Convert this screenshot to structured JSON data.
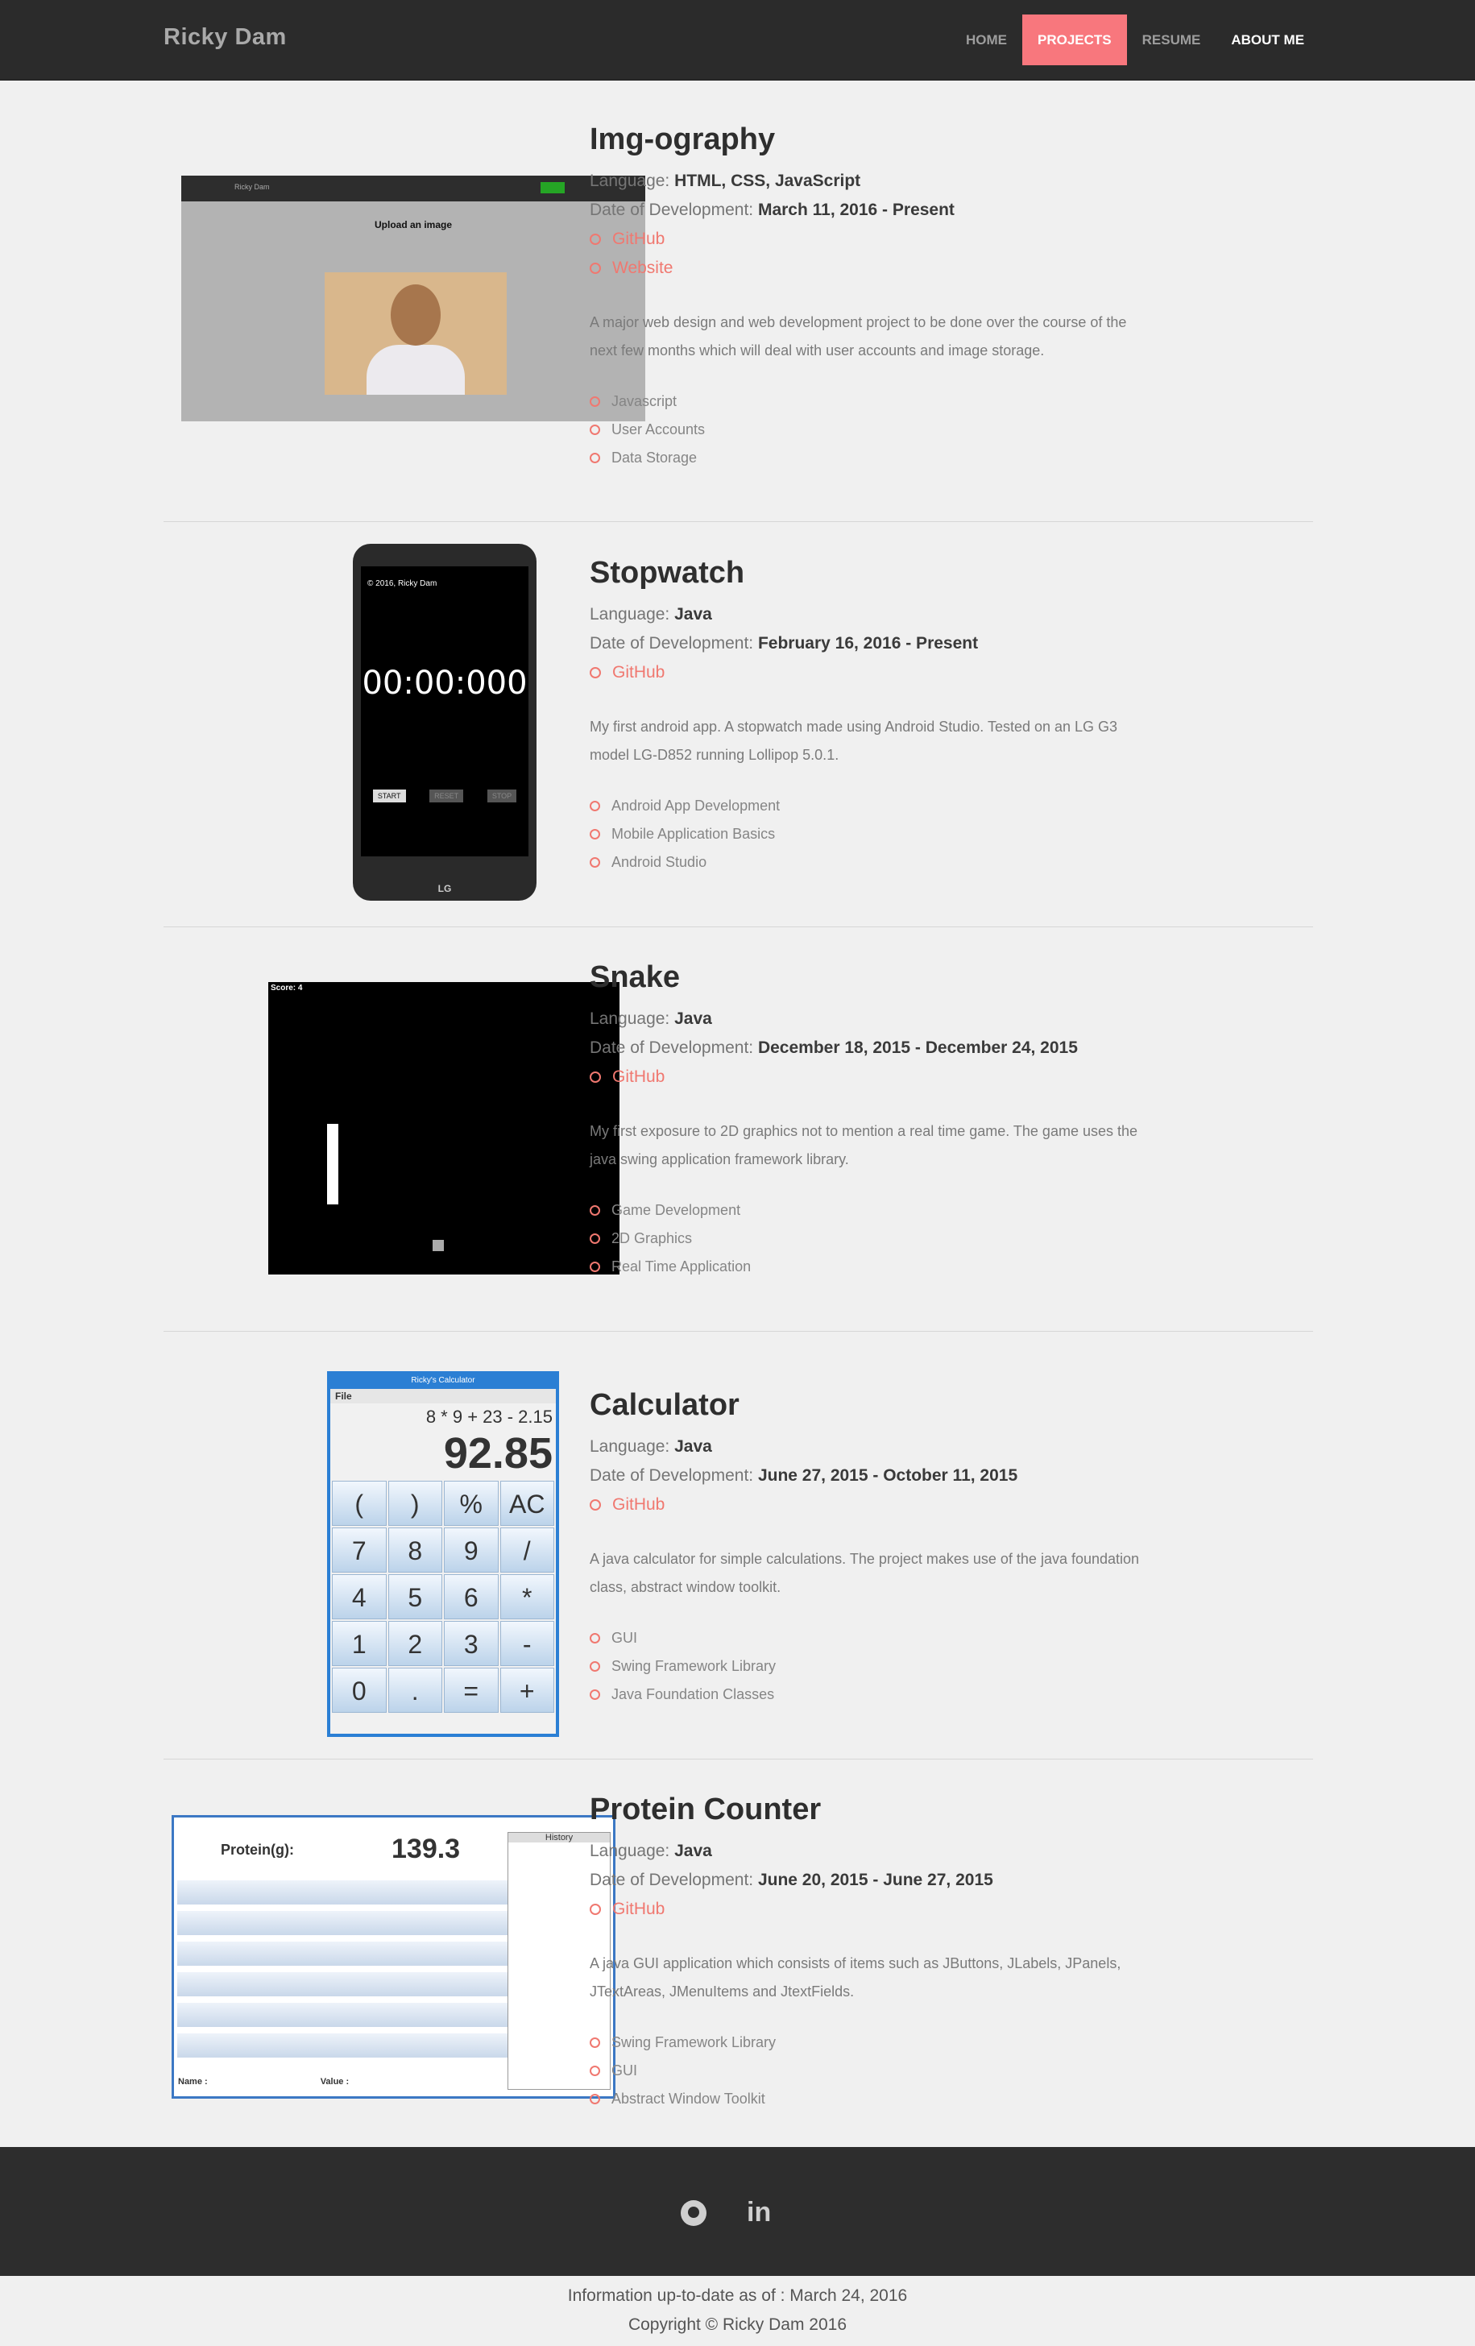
{
  "header": {
    "brand": "Ricky Dam",
    "nav": [
      "HOME",
      "PROJECTS",
      "RESUME",
      "ABOUT ME"
    ]
  },
  "projects": [
    {
      "title": "Img-ography",
      "language_label": "Language: ",
      "language": "HTML, CSS, JavaScript",
      "date_label": "Date of Development: ",
      "date": "March 11, 2016 - Present",
      "links": [
        "GitHub",
        "Website"
      ],
      "description": "A major web design and web development project to be done over the course of the next few months which will deal with user accounts and image storage.",
      "tags": [
        "Javascript",
        "User Accounts",
        "Data Storage"
      ],
      "screenshot": {
        "brand": "Ricky Dam",
        "heading": "Upload an image"
      }
    },
    {
      "title": "Stopwatch",
      "language_label": "Language: ",
      "language": "Java",
      "date_label": "Date of Development: ",
      "date": "February 16, 2016 - Present",
      "links": [
        "GitHub"
      ],
      "description": "My first android app. A stopwatch made using Android Studio. Tested on an LG G3 model LG-D852 running Lollipop 5.0.1.",
      "tags": [
        "Android App Development",
        "Mobile Application Basics",
        "Android Studio"
      ],
      "screenshot": {
        "copyright": "© 2016, Ricky Dam",
        "time": "00:00:000",
        "buttons": [
          "START",
          "RESET",
          "STOP"
        ],
        "brand": "LG"
      }
    },
    {
      "title": "Snake",
      "language_label": "Language: ",
      "language": "Java",
      "date_label": "Date of Development: ",
      "date": "December 18, 2015 - December 24, 2015",
      "links": [
        "GitHub"
      ],
      "description": "My first exposure to 2D graphics not to mention a real time game. The game uses the java swing application framework library.",
      "tags": [
        "Game Development",
        "2D Graphics",
        "Real Time Application"
      ],
      "screenshot": {
        "score": "Score: 4"
      }
    },
    {
      "title": "Calculator",
      "language_label": "Language: ",
      "language": "Java",
      "date_label": "Date of Development: ",
      "date": "June 27, 2015 - October 11, 2015",
      "links": [
        "GitHub"
      ],
      "description": "A java calculator for simple calculations. The project makes use of the java foundation class, abstract window toolkit.",
      "tags": [
        "GUI",
        "Swing Framework Library",
        "Java Foundation Classes"
      ],
      "screenshot": {
        "window_title": "Ricky's Calculator",
        "menu": "File",
        "expression": "8 * 9 + 23 - 2.15",
        "result": "92.85",
        "keys": [
          "(",
          ")",
          "%",
          "AC",
          "7",
          "8",
          "9",
          "/",
          "4",
          "5",
          "6",
          "*",
          "1",
          "2",
          "3",
          "-",
          "0",
          ".",
          "=",
          "+"
        ]
      }
    },
    {
      "title": "Protein Counter",
      "language_label": "Language: ",
      "language": "Java",
      "date_label": "Date of Development: ",
      "date": "June 20, 2015 - June 27, 2015",
      "links": [
        "GitHub"
      ],
      "description": "A java GUI application which consists of items such as JButtons, JLabels, JPanels, JTextAreas, JMenuItems and JtextFields.",
      "tags": [
        "Swing Framework Library",
        "GUI",
        "Abstract Window Toolkit"
      ],
      "screenshot": {
        "label": "Protein(g):",
        "value": "139.3",
        "history": "History",
        "name_label": "Name :",
        "value_label": "Value :"
      }
    }
  ],
  "footer": {
    "icons": [
      "github-icon",
      "linkedin-icon"
    ],
    "linkedin_text": "in",
    "updated": "Information up-to-date as of : March 24, 2016",
    "copyright": "Copyright © Ricky Dam 2016"
  }
}
